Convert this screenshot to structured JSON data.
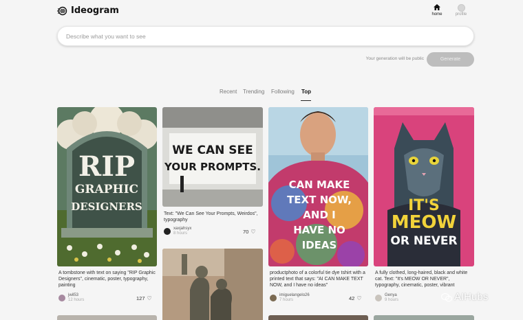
{
  "header": {
    "brand": "Ideogram",
    "nav": {
      "home": "home",
      "profile": "profile"
    }
  },
  "search": {
    "placeholder": "Describe what you want to see"
  },
  "generate": {
    "note": "Your generation will be public",
    "button": "Generate"
  },
  "tabs": [
    "Recent",
    "Trending",
    "Following",
    "Top"
  ],
  "active_tab": "Top",
  "cards": [
    {
      "image_text": [
        "RIP",
        "GRAPHIC",
        "DESIGNERS"
      ],
      "caption": "A tombstone with text on saying \"RIP Graphic Designers\", cinematic, poster, typography, painting",
      "author": "jwil53",
      "time": "12 hours",
      "likes": "127"
    },
    {
      "image_text": [
        "WE CAN SEE",
        "YOUR PROMPTS."
      ],
      "caption": "Text: \"We Can See Your Prompts, Weirdos\", typography",
      "author": "xaxjahsyx",
      "time": "8 hours",
      "likes": "70"
    },
    {
      "image_text": [
        "CAN MAKE",
        "TEXT NOW,",
        "AND I",
        "HAVE NO",
        "IDEAS"
      ],
      "caption": "productphoto of a colorful tie dye tshirt with a printed text that says: \"AI CAN MAKE TEXT NOW, and I have no ideas\"",
      "author": "imiguelangelo26",
      "time": "7 hours",
      "likes": "42"
    },
    {
      "image_text": [
        "IT'S",
        "MEOW",
        "OR NEVER"
      ],
      "caption": "A fully clothed, long-haired, black and white cat. Text: \"It's MEOW OR NEVER\", typography, cinematic, poster, vibrant",
      "author": "Genya",
      "time": "9 hours",
      "likes": ""
    }
  ],
  "watermark": "AIHubs",
  "colors": {
    "generate_bg": "#bdbdbd",
    "page_bg": "#f5f5f5"
  }
}
